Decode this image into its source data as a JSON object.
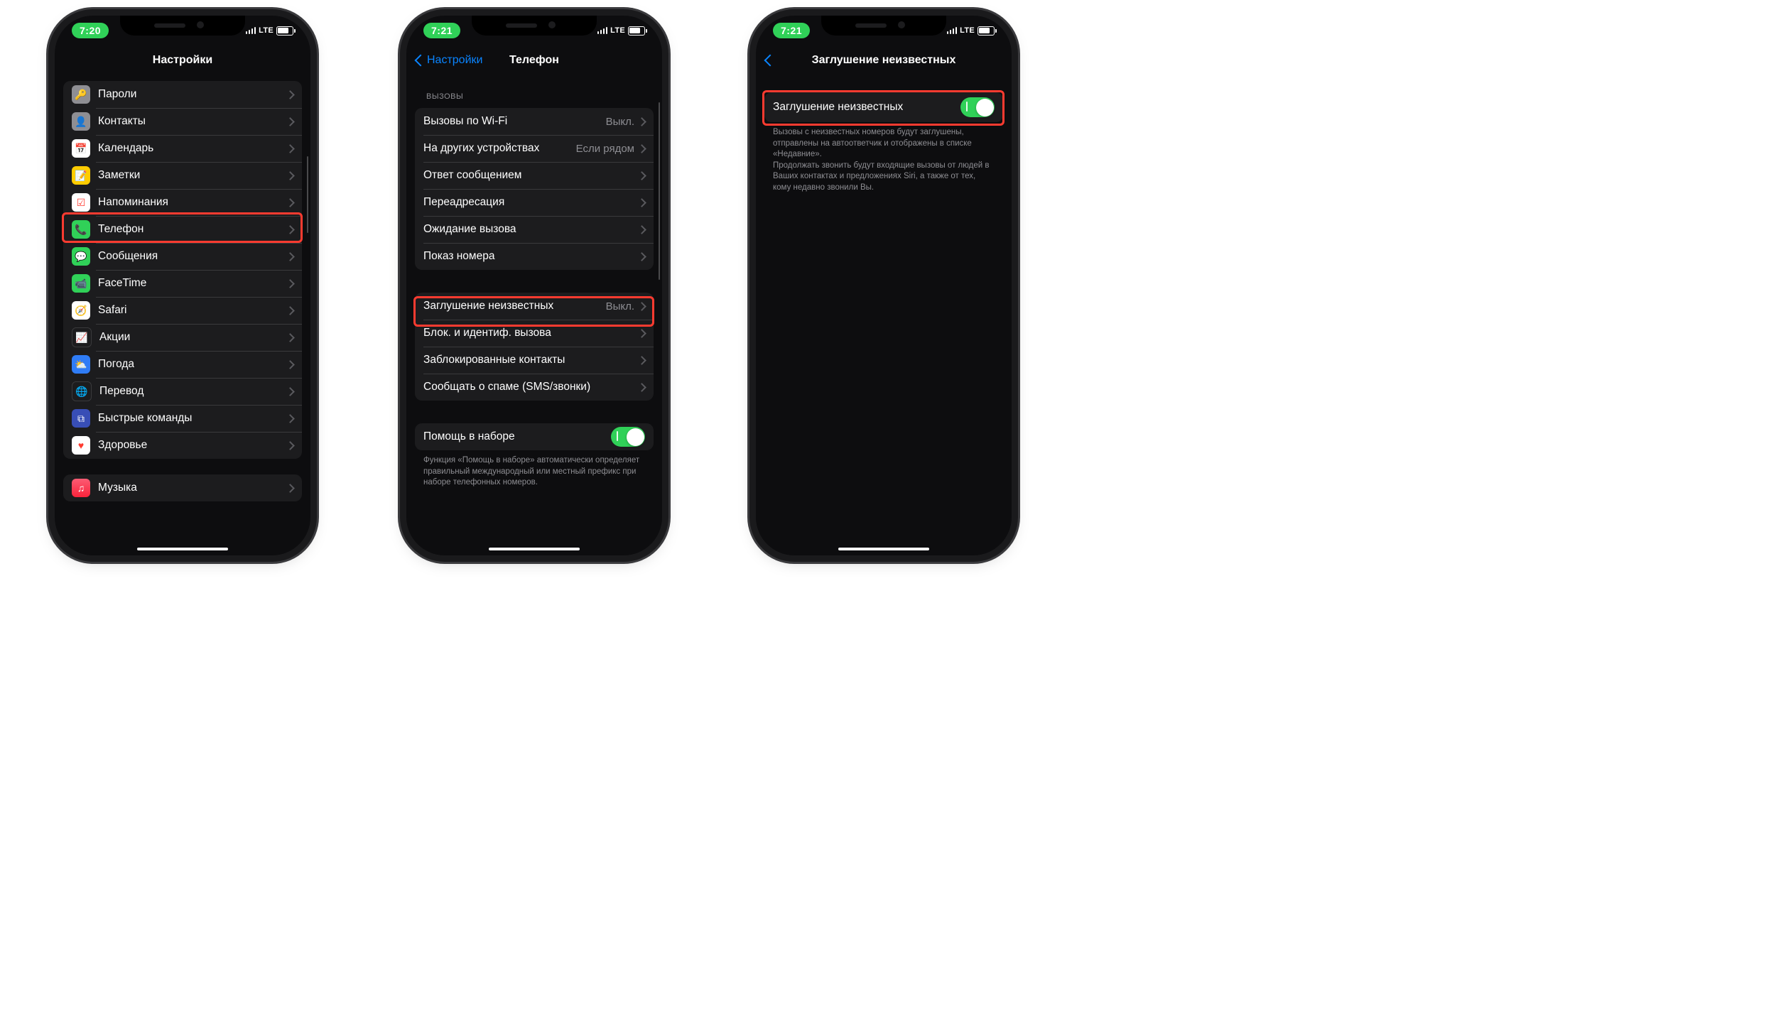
{
  "status": {
    "lte": "LTE"
  },
  "phone1": {
    "time": "7:20",
    "title": "Настройки",
    "items": [
      {
        "id": "passwords",
        "label": "Пароли"
      },
      {
        "id": "contacts",
        "label": "Контакты"
      },
      {
        "id": "calendar",
        "label": "Календарь"
      },
      {
        "id": "notes",
        "label": "Заметки"
      },
      {
        "id": "reminders",
        "label": "Напоминания"
      },
      {
        "id": "phone",
        "label": "Телефон"
      },
      {
        "id": "messages",
        "label": "Сообщения"
      },
      {
        "id": "facetime",
        "label": "FaceTime"
      },
      {
        "id": "safari",
        "label": "Safari"
      },
      {
        "id": "stocks",
        "label": "Акции"
      },
      {
        "id": "weather",
        "label": "Погода"
      },
      {
        "id": "translate",
        "label": "Перевод"
      },
      {
        "id": "shortcuts",
        "label": "Быстрые команды"
      },
      {
        "id": "health",
        "label": "Здоровье"
      },
      {
        "id": "music",
        "label": "Музыка"
      }
    ]
  },
  "phone2": {
    "time": "7:21",
    "back": "Настройки",
    "title": "Телефон",
    "section_calls": "ВЫЗОВЫ",
    "rows": {
      "wifi_calling": {
        "label": "Вызовы по Wi-Fi",
        "value": "Выкл."
      },
      "other_devices": {
        "label": "На других устройствах",
        "value": "Если рядом"
      },
      "text_reply": {
        "label": "Ответ сообщением"
      },
      "forwarding": {
        "label": "Переадресация"
      },
      "waiting": {
        "label": "Ожидание вызова"
      },
      "caller_id": {
        "label": "Показ номера"
      },
      "silence_unknown": {
        "label": "Заглушение неизвестных",
        "value": "Выкл."
      },
      "block_id": {
        "label": "Блок. и идентиф. вызова"
      },
      "blocked": {
        "label": "Заблокированные контакты"
      },
      "spam": {
        "label": "Сообщать о спаме (SMS/звонки)"
      },
      "dial_assist": {
        "label": "Помощь в наборе"
      }
    },
    "footer": "Функция «Помощь в наборе» автоматически определяет правильный международный или местный префикс при наборе телефонных номеров."
  },
  "phone3": {
    "time": "7:21",
    "title": "Заглушение неизвестных",
    "toggle_label": "Заглушение неизвестных",
    "footer": "Вызовы с неизвестных номеров будут заглушены, отправлены на автоответчик и отображены в списке «Недавние».\nПродолжать звонить будут входящие вызовы от людей в Ваших контактах и предложениях Siri, а также от тех, кому недавно звонили Вы."
  }
}
